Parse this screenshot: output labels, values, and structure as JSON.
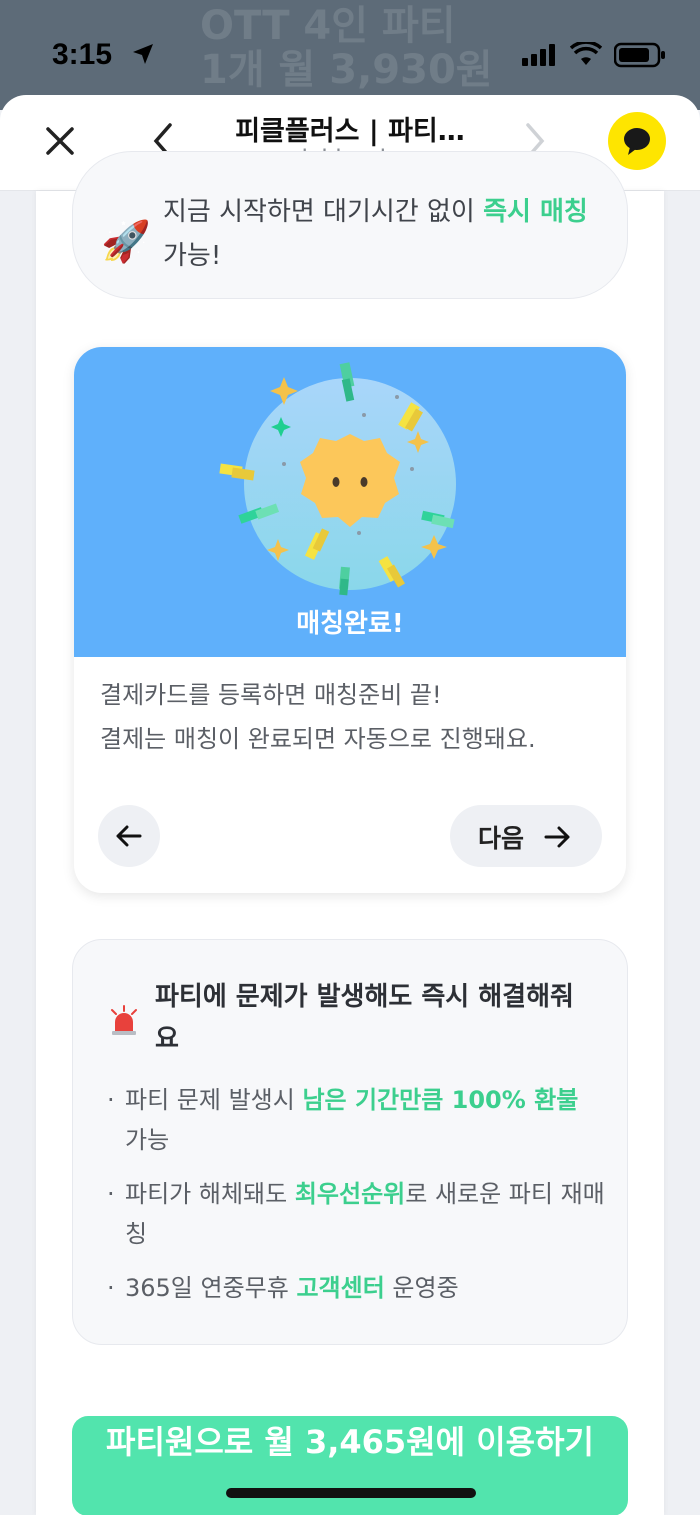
{
  "status": {
    "time": "3:15"
  },
  "background_banner": {
    "line1": "OTT 4인 파티",
    "line2": "1개 월 3,930원"
  },
  "header": {
    "title": "피클플러스 | 파티…",
    "url": "pickle.plus"
  },
  "pill": {
    "text_before": "지금 시작하면 대기시간 없이 ",
    "highlight": "즉시 매칭",
    "text_after": " 가능!"
  },
  "card": {
    "image_label": "매칭완료!",
    "desc_line1": "결제카드를 등록하면 매칭준비 끝!",
    "desc_line2": "결제는 매칭이 완료되면 자동으로 진행돼요.",
    "next_label": "다음"
  },
  "info": {
    "title": "파티에 문제가 발생해도 즉시 해결해줘요",
    "bullets": [
      {
        "before": "파티 문제 발생시 ",
        "highlight": "남은 기간만큼 100% 환불",
        "after": " 가능"
      },
      {
        "before": "파티가 해체돼도 ",
        "highlight": "최우선순위",
        "after": "로 새로운 파티 재매칭"
      },
      {
        "before": "365일 연중무휴 ",
        "highlight": "고객센터",
        "after": " 운영중"
      }
    ]
  },
  "cta": {
    "label": "파티원으로 월 3,465원에 이용하기"
  },
  "colors": {
    "accent_green": "#3ccf8e",
    "cta_green": "#52e4ad",
    "card_blue": "#5fb0fb",
    "kakao_yellow": "#fee500"
  }
}
